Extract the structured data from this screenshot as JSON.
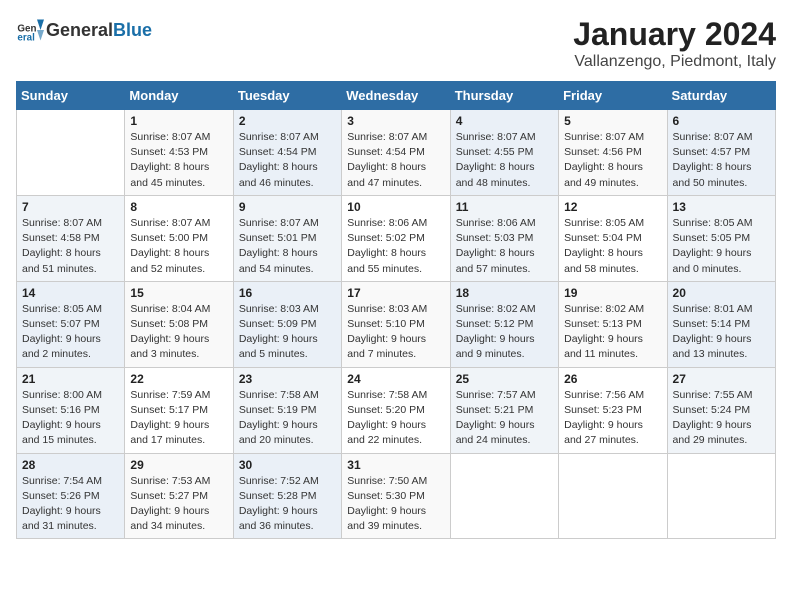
{
  "header": {
    "title": "January 2024",
    "subtitle": "Vallanzengo, Piedmont, Italy",
    "logo_general": "General",
    "logo_blue": "Blue"
  },
  "weekdays": [
    "Sunday",
    "Monday",
    "Tuesday",
    "Wednesday",
    "Thursday",
    "Friday",
    "Saturday"
  ],
  "weeks": [
    [
      {
        "day": "",
        "info": ""
      },
      {
        "day": "1",
        "info": "Sunrise: 8:07 AM\nSunset: 4:53 PM\nDaylight: 8 hours\nand 45 minutes."
      },
      {
        "day": "2",
        "info": "Sunrise: 8:07 AM\nSunset: 4:54 PM\nDaylight: 8 hours\nand 46 minutes."
      },
      {
        "day": "3",
        "info": "Sunrise: 8:07 AM\nSunset: 4:54 PM\nDaylight: 8 hours\nand 47 minutes."
      },
      {
        "day": "4",
        "info": "Sunrise: 8:07 AM\nSunset: 4:55 PM\nDaylight: 8 hours\nand 48 minutes."
      },
      {
        "day": "5",
        "info": "Sunrise: 8:07 AM\nSunset: 4:56 PM\nDaylight: 8 hours\nand 49 minutes."
      },
      {
        "day": "6",
        "info": "Sunrise: 8:07 AM\nSunset: 4:57 PM\nDaylight: 8 hours\nand 50 minutes."
      }
    ],
    [
      {
        "day": "7",
        "info": "Sunrise: 8:07 AM\nSunset: 4:58 PM\nDaylight: 8 hours\nand 51 minutes."
      },
      {
        "day": "8",
        "info": "Sunrise: 8:07 AM\nSunset: 5:00 PM\nDaylight: 8 hours\nand 52 minutes."
      },
      {
        "day": "9",
        "info": "Sunrise: 8:07 AM\nSunset: 5:01 PM\nDaylight: 8 hours\nand 54 minutes."
      },
      {
        "day": "10",
        "info": "Sunrise: 8:06 AM\nSunset: 5:02 PM\nDaylight: 8 hours\nand 55 minutes."
      },
      {
        "day": "11",
        "info": "Sunrise: 8:06 AM\nSunset: 5:03 PM\nDaylight: 8 hours\nand 57 minutes."
      },
      {
        "day": "12",
        "info": "Sunrise: 8:05 AM\nSunset: 5:04 PM\nDaylight: 8 hours\nand 58 minutes."
      },
      {
        "day": "13",
        "info": "Sunrise: 8:05 AM\nSunset: 5:05 PM\nDaylight: 9 hours\nand 0 minutes."
      }
    ],
    [
      {
        "day": "14",
        "info": "Sunrise: 8:05 AM\nSunset: 5:07 PM\nDaylight: 9 hours\nand 2 minutes."
      },
      {
        "day": "15",
        "info": "Sunrise: 8:04 AM\nSunset: 5:08 PM\nDaylight: 9 hours\nand 3 minutes."
      },
      {
        "day": "16",
        "info": "Sunrise: 8:03 AM\nSunset: 5:09 PM\nDaylight: 9 hours\nand 5 minutes."
      },
      {
        "day": "17",
        "info": "Sunrise: 8:03 AM\nSunset: 5:10 PM\nDaylight: 9 hours\nand 7 minutes."
      },
      {
        "day": "18",
        "info": "Sunrise: 8:02 AM\nSunset: 5:12 PM\nDaylight: 9 hours\nand 9 minutes."
      },
      {
        "day": "19",
        "info": "Sunrise: 8:02 AM\nSunset: 5:13 PM\nDaylight: 9 hours\nand 11 minutes."
      },
      {
        "day": "20",
        "info": "Sunrise: 8:01 AM\nSunset: 5:14 PM\nDaylight: 9 hours\nand 13 minutes."
      }
    ],
    [
      {
        "day": "21",
        "info": "Sunrise: 8:00 AM\nSunset: 5:16 PM\nDaylight: 9 hours\nand 15 minutes."
      },
      {
        "day": "22",
        "info": "Sunrise: 7:59 AM\nSunset: 5:17 PM\nDaylight: 9 hours\nand 17 minutes."
      },
      {
        "day": "23",
        "info": "Sunrise: 7:58 AM\nSunset: 5:19 PM\nDaylight: 9 hours\nand 20 minutes."
      },
      {
        "day": "24",
        "info": "Sunrise: 7:58 AM\nSunset: 5:20 PM\nDaylight: 9 hours\nand 22 minutes."
      },
      {
        "day": "25",
        "info": "Sunrise: 7:57 AM\nSunset: 5:21 PM\nDaylight: 9 hours\nand 24 minutes."
      },
      {
        "day": "26",
        "info": "Sunrise: 7:56 AM\nSunset: 5:23 PM\nDaylight: 9 hours\nand 27 minutes."
      },
      {
        "day": "27",
        "info": "Sunrise: 7:55 AM\nSunset: 5:24 PM\nDaylight: 9 hours\nand 29 minutes."
      }
    ],
    [
      {
        "day": "28",
        "info": "Sunrise: 7:54 AM\nSunset: 5:26 PM\nDaylight: 9 hours\nand 31 minutes."
      },
      {
        "day": "29",
        "info": "Sunrise: 7:53 AM\nSunset: 5:27 PM\nDaylight: 9 hours\nand 34 minutes."
      },
      {
        "day": "30",
        "info": "Sunrise: 7:52 AM\nSunset: 5:28 PM\nDaylight: 9 hours\nand 36 minutes."
      },
      {
        "day": "31",
        "info": "Sunrise: 7:50 AM\nSunset: 5:30 PM\nDaylight: 9 hours\nand 39 minutes."
      },
      {
        "day": "",
        "info": ""
      },
      {
        "day": "",
        "info": ""
      },
      {
        "day": "",
        "info": ""
      }
    ]
  ]
}
